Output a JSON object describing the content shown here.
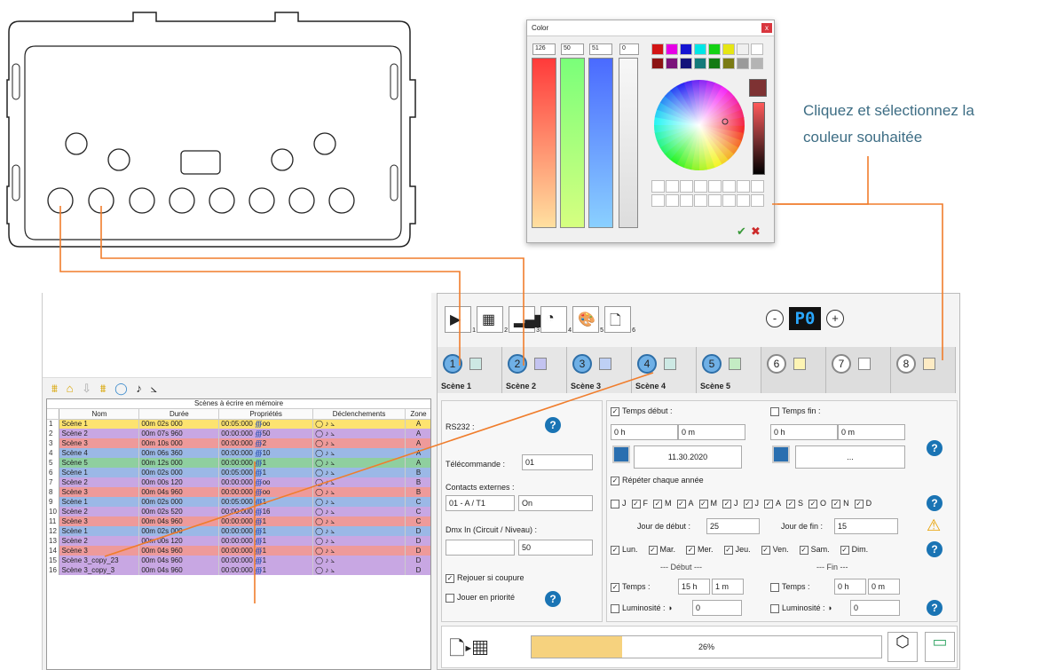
{
  "color_dialog": {
    "title": "Color",
    "close_label": "x",
    "red_value": "126",
    "green_value": "50",
    "blue_value": "51",
    "alpha_value": "0",
    "swatches": [
      "#d21414",
      "#e600e6",
      "#1414d2",
      "#00e6e6",
      "#14d214",
      "#e6e614",
      "#f0f0f0",
      "#ffffff",
      "#8c1414",
      "#7a147a",
      "#14147a",
      "#147a7a",
      "#147a14",
      "#7a7a14",
      "#9a9a9a",
      "#b4b4b4"
    ],
    "current_color": "#7e3233",
    "ok_label": "✔",
    "cancel_label": "✖"
  },
  "callout": {
    "line1": "Cliquez et sélectionnez la",
    "line2": "couleur souhaitée"
  },
  "toolbar": {
    "buttons": [
      {
        "icon": "play-icon",
        "sub": "1"
      },
      {
        "icon": "layout-icon",
        "sub": "2"
      },
      {
        "icon": "signal-icon",
        "sub": "3"
      },
      {
        "icon": "gauge-icon",
        "sub": "4"
      },
      {
        "icon": "palette-icon",
        "sub": "5"
      },
      {
        "icon": "file-icon",
        "sub": "6"
      }
    ],
    "minus": "-",
    "preset": "P0",
    "plus": "+"
  },
  "scene_tabs": [
    {
      "num": "1",
      "label": "Scène 1",
      "color": "#cde9e4"
    },
    {
      "num": "2",
      "label": "Scène 2",
      "color": "#c3c3f0"
    },
    {
      "num": "3",
      "label": "Scène 3",
      "color": "#bed0f5"
    },
    {
      "num": "4",
      "label": "Scène 4",
      "color": "#cde9e4"
    },
    {
      "num": "5",
      "label": "Scène 5",
      "color": "#c4ecc4"
    },
    {
      "num": "6",
      "label": "",
      "color": "#fdf4b4"
    },
    {
      "num": "7",
      "label": "",
      "color": "#ffffff"
    },
    {
      "num": "8",
      "label": "",
      "color": "#fdebc4"
    }
  ],
  "table": {
    "title": "Scènes à écrire en mémoire",
    "headers": [
      "Nom",
      "Durée",
      "Propriétés",
      "Déclenchements",
      "Zone"
    ],
    "rows": [
      {
        "n": "1",
        "name": "Scène 1",
        "dur": "00m 02s 000",
        "prop": "00:05:000",
        "cnt": "oo",
        "zone": "A",
        "color": "#fde370"
      },
      {
        "n": "2",
        "name": "Scène 2",
        "dur": "00m 07s 960",
        "prop": "00:00:000",
        "cnt": "50",
        "zone": "A",
        "color": "#c8a7e3"
      },
      {
        "n": "3",
        "name": "Scène 3",
        "dur": "00m 10s 000",
        "prop": "00:00:000",
        "cnt": "2",
        "zone": "A",
        "color": "#ee9a9a"
      },
      {
        "n": "4",
        "name": "Scène 4",
        "dur": "00m 06s 360",
        "prop": "00:00:000",
        "cnt": "10",
        "zone": "A",
        "color": "#9bb8e6"
      },
      {
        "n": "5",
        "name": "Scène 5",
        "dur": "00m 12s 000",
        "prop": "00:00:000",
        "cnt": "1",
        "zone": "A",
        "color": "#8fcf9f"
      },
      {
        "n": "6",
        "name": "Scène 1",
        "dur": "00m 02s 000",
        "prop": "00:05:000",
        "cnt": "1",
        "zone": "B",
        "color": "#9bb8e6"
      },
      {
        "n": "7",
        "name": "Scène 2",
        "dur": "00m 00s 120",
        "prop": "00:00:000",
        "cnt": "oo",
        "zone": "B",
        "color": "#c8a7e3"
      },
      {
        "n": "8",
        "name": "Scène 3",
        "dur": "00m 04s 960",
        "prop": "00:00:000",
        "cnt": "oo",
        "zone": "B",
        "color": "#ee9a9a"
      },
      {
        "n": "9",
        "name": "Scène 1",
        "dur": "00m 02s 000",
        "prop": "00:05:000",
        "cnt": "1",
        "zone": "C",
        "color": "#9bb8e6"
      },
      {
        "n": "10",
        "name": "Scène 2",
        "dur": "00m 02s 520",
        "prop": "00:00:000",
        "cnt": "16",
        "zone": "C",
        "color": "#c8a7e3"
      },
      {
        "n": "11",
        "name": "Scène 3",
        "dur": "00m 04s 960",
        "prop": "00:00:000",
        "cnt": "1",
        "zone": "C",
        "color": "#ee9a9a"
      },
      {
        "n": "12",
        "name": "Scène 1",
        "dur": "00m 02s 000",
        "prop": "00:00:000",
        "cnt": "1",
        "zone": "D",
        "color": "#9bb8e6"
      },
      {
        "n": "13",
        "name": "Scène 2",
        "dur": "00m 00s 120",
        "prop": "00:00:000",
        "cnt": "1",
        "zone": "D",
        "color": "#c8a7e3"
      },
      {
        "n": "14",
        "name": "Scène 3",
        "dur": "00m 04s 960",
        "prop": "00:00:000",
        "cnt": "1",
        "zone": "D",
        "color": "#ee9a9a"
      },
      {
        "n": "15",
        "name": "Scène 3_copy_23",
        "dur": "00m 04s 960",
        "prop": "00:00:000",
        "cnt": "1",
        "zone": "D",
        "color": "#c8a7e3"
      },
      {
        "n": "16",
        "name": "Scène 3_copy_3",
        "dur": "00m 04s 960",
        "prop": "00:00:000",
        "cnt": "1",
        "zone": "D",
        "color": "#c8a7e3"
      }
    ]
  },
  "form": {
    "rs232": "RS232 :",
    "telecommande": "Télécommande :",
    "telecommande_value": "01",
    "contacts": "Contacts externes :",
    "contacts_value": "01 - A / T1",
    "contacts_state": "On",
    "dmx": "Dmx In (Circuit / Niveau) :",
    "dmx_level": "50",
    "rejouer": "Rejouer si coupure",
    "jouer": "Jouer en priorité",
    "temps_debut": "Temps début :",
    "temps_fin": "Temps fin :",
    "h0": "0 h",
    "m0": "0 m",
    "date": "11.30.2020",
    "date_empty": "...",
    "repeter": "Répéter chaque année",
    "months": [
      "J",
      "F",
      "M",
      "A",
      "M",
      "J",
      "J",
      "A",
      "S",
      "O",
      "N",
      "D"
    ],
    "jour_debut": "Jour de début :",
    "jour_debut_val": "25",
    "jour_fin": "Jour de fin :",
    "jour_fin_val": "15",
    "days": [
      "Lun.",
      "Mar.",
      "Mer.",
      "Jeu.",
      "Ven.",
      "Sam.",
      "Dim."
    ],
    "debut_hdr": "--- Début ---",
    "fin_hdr": "--- Fin ---",
    "temps": "Temps :",
    "h15": "15 h",
    "m1": "1 m",
    "luminosite": "Luminosité :",
    "lum_val": "0"
  },
  "progress": {
    "value": 0.26,
    "label": "26%"
  }
}
